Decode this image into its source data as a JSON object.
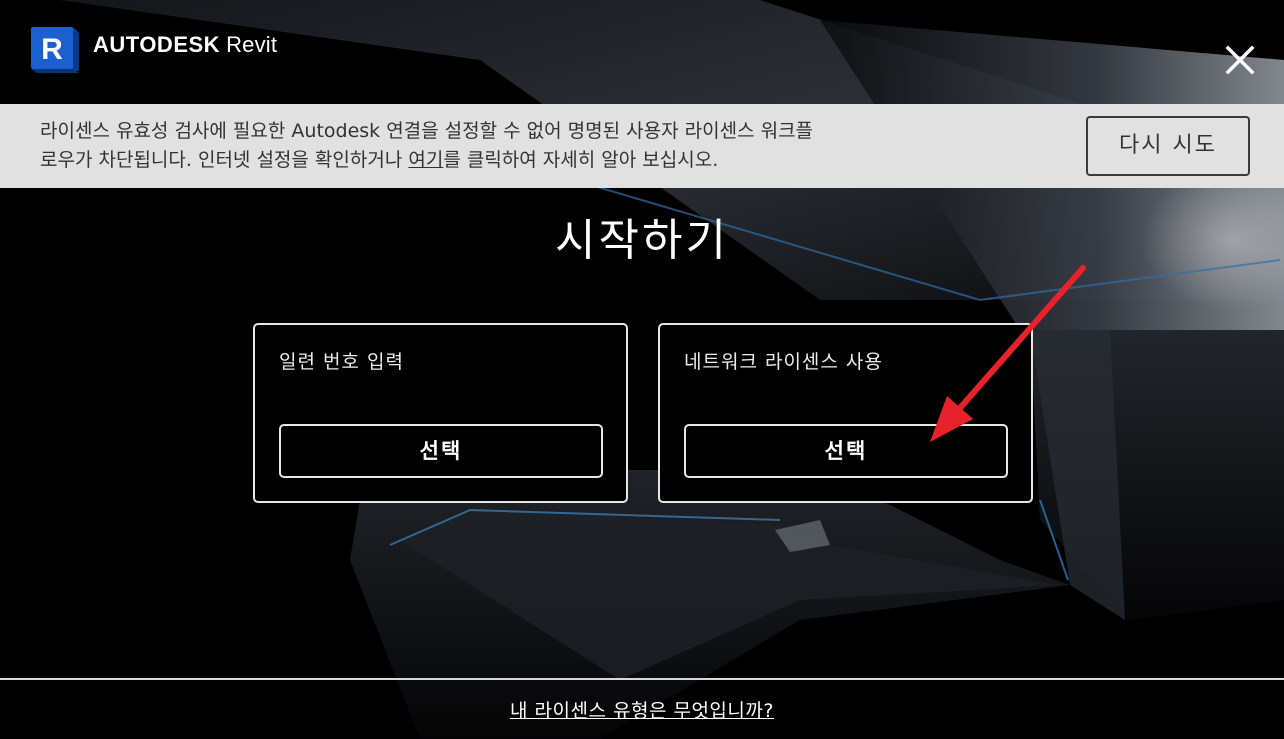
{
  "header": {
    "brand_company": "AUTODESK",
    "brand_product": "Revit",
    "logo_letter": "R",
    "logo_color": "#1b5fd1",
    "close_icon": "close-icon"
  },
  "banner": {
    "message_line1": "라이센스 유효성 검사에 필요한 Autodesk 연결을 설정할 수 없어 명명된 사용자 라이센스 워크플",
    "message_line2_before": "로우가 차단됩니다. 인터넷 설정을 확인하거나 ",
    "message_link": "여기",
    "message_line2_after": "를 클릭하여 자세히 알아 보십시오.",
    "retry_label": "다시 시도",
    "background_color": "#e1e1e1"
  },
  "main": {
    "title": "시작하기",
    "options": [
      {
        "label": "일련 번호 입력",
        "button_label": "선택"
      },
      {
        "label": "네트워크 라이센스 사용",
        "button_label": "선택"
      }
    ]
  },
  "annotation": {
    "arrow_color": "#e8222a"
  },
  "footer": {
    "link_label": "내 라이센스 유형은 무엇입니까?"
  }
}
